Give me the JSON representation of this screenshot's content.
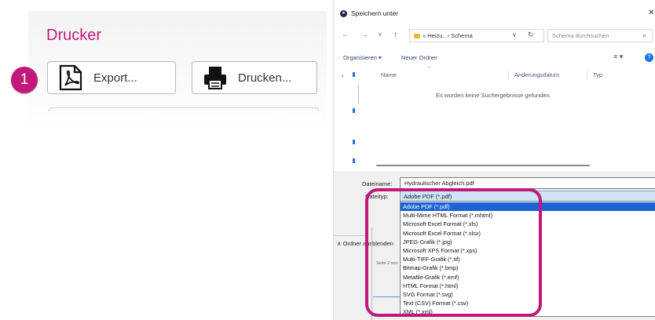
{
  "left": {
    "section_title": "Drucker",
    "step_number": "1",
    "export_label": "Export...",
    "print_label": "Drucken..."
  },
  "dialog": {
    "title": "Speichern unter",
    "close_glyph": "✕",
    "breadcrumb": "« Heizu.. › Schema",
    "search_placeholder": "Schema durchsuchen",
    "commands": {
      "organize": "Organisieren ▾",
      "new_folder": "Neuer Ordner"
    },
    "columns": {
      "name": "Name",
      "modified": "Änderungsdatum",
      "type": "Typ"
    },
    "empty_message": "Es wurden keine Suchergebnisse gefunden.",
    "filename_label": "Dateiname:",
    "filename_value": "Hydraulischer Abgleich.pdf",
    "filetype_label": "Dateityp:",
    "filetype_value": "Adobe PDF (*.pdf)",
    "hide_folders": "∧ Ordner ausblenden",
    "page_info": "Seite 2 von",
    "filetype_options": [
      "Adobe PDF (*.pdf)",
      "Multi-Mime HTML Format (*.mhtml)",
      "Microsoft Excel Format (*.xls)",
      "Microsoft Excel Format (*.xlsx)",
      "JPEG-Grafik (*.jpg)",
      "Microsoft XPS Format (*.xps)",
      "Multi-TIFF-Grafik (*.tif)",
      "Bitmap-Grafik (*.bmp)",
      "Metafile-Grafik (*.emf)",
      "HTML Format (*.html)",
      "SVG Format (*.svg)",
      "Text (CSV) Format (*.csv)",
      "XML (*.xml)"
    ],
    "selected_option": 0
  },
  "colors": {
    "accent": "#c2187c",
    "selection": "#1e63d6",
    "link": "#2a4a7a"
  },
  "icons": [
    "pdf-icon",
    "printer-icon",
    "back-arrow-icon",
    "forward-arrow-icon",
    "up-arrow-icon",
    "folder-icon",
    "refresh-icon",
    "search-icon",
    "help-icon"
  ]
}
